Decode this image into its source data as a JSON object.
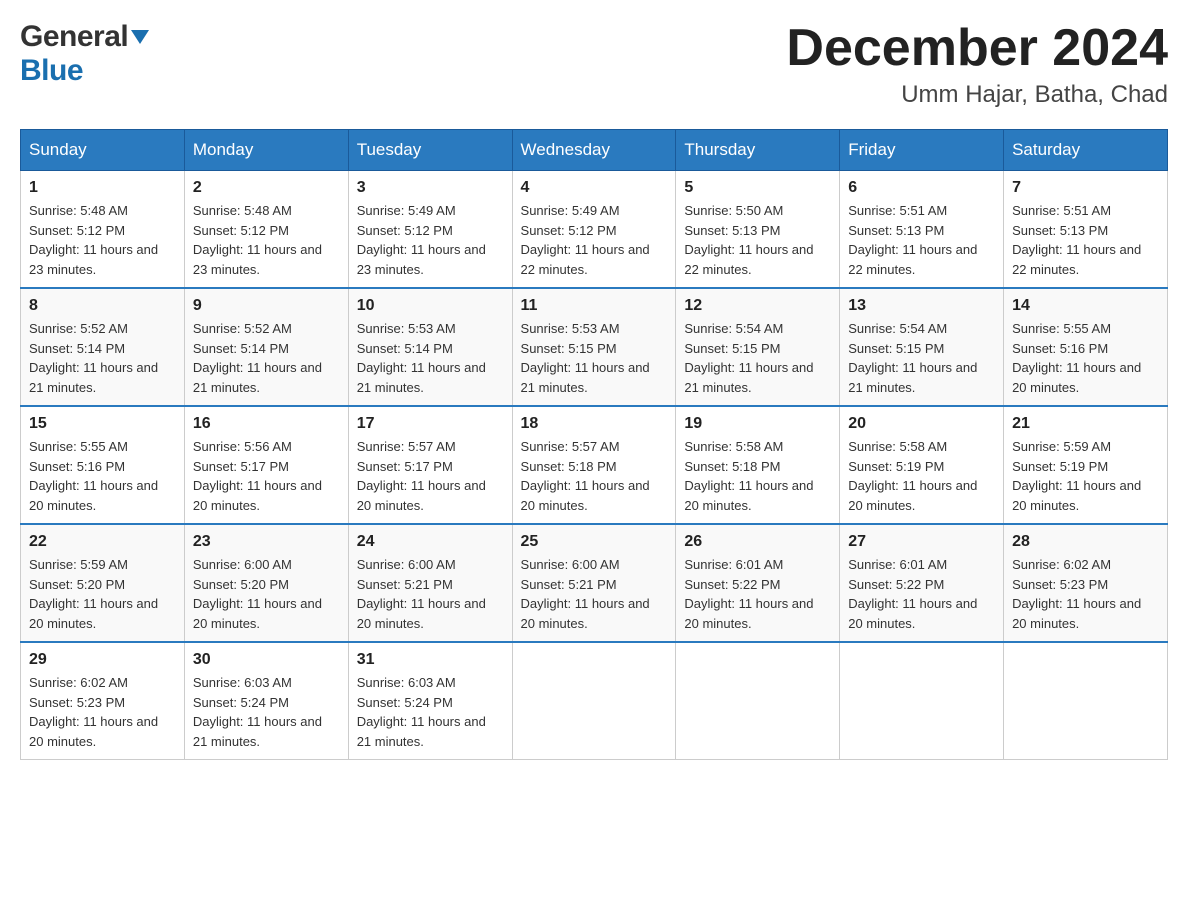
{
  "logo": {
    "general_text": "General",
    "blue_text": "Blue"
  },
  "header": {
    "month_year": "December 2024",
    "location": "Umm Hajar, Batha, Chad"
  },
  "days_of_week": [
    "Sunday",
    "Monday",
    "Tuesday",
    "Wednesday",
    "Thursday",
    "Friday",
    "Saturday"
  ],
  "weeks": [
    [
      {
        "day": "1",
        "sunrise": "5:48 AM",
        "sunset": "5:12 PM",
        "daylight": "11 hours and 23 minutes."
      },
      {
        "day": "2",
        "sunrise": "5:48 AM",
        "sunset": "5:12 PM",
        "daylight": "11 hours and 23 minutes."
      },
      {
        "day": "3",
        "sunrise": "5:49 AM",
        "sunset": "5:12 PM",
        "daylight": "11 hours and 23 minutes."
      },
      {
        "day": "4",
        "sunrise": "5:49 AM",
        "sunset": "5:12 PM",
        "daylight": "11 hours and 22 minutes."
      },
      {
        "day": "5",
        "sunrise": "5:50 AM",
        "sunset": "5:13 PM",
        "daylight": "11 hours and 22 minutes."
      },
      {
        "day": "6",
        "sunrise": "5:51 AM",
        "sunset": "5:13 PM",
        "daylight": "11 hours and 22 minutes."
      },
      {
        "day": "7",
        "sunrise": "5:51 AM",
        "sunset": "5:13 PM",
        "daylight": "11 hours and 22 minutes."
      }
    ],
    [
      {
        "day": "8",
        "sunrise": "5:52 AM",
        "sunset": "5:14 PM",
        "daylight": "11 hours and 21 minutes."
      },
      {
        "day": "9",
        "sunrise": "5:52 AM",
        "sunset": "5:14 PM",
        "daylight": "11 hours and 21 minutes."
      },
      {
        "day": "10",
        "sunrise": "5:53 AM",
        "sunset": "5:14 PM",
        "daylight": "11 hours and 21 minutes."
      },
      {
        "day": "11",
        "sunrise": "5:53 AM",
        "sunset": "5:15 PM",
        "daylight": "11 hours and 21 minutes."
      },
      {
        "day": "12",
        "sunrise": "5:54 AM",
        "sunset": "5:15 PM",
        "daylight": "11 hours and 21 minutes."
      },
      {
        "day": "13",
        "sunrise": "5:54 AM",
        "sunset": "5:15 PM",
        "daylight": "11 hours and 21 minutes."
      },
      {
        "day": "14",
        "sunrise": "5:55 AM",
        "sunset": "5:16 PM",
        "daylight": "11 hours and 20 minutes."
      }
    ],
    [
      {
        "day": "15",
        "sunrise": "5:55 AM",
        "sunset": "5:16 PM",
        "daylight": "11 hours and 20 minutes."
      },
      {
        "day": "16",
        "sunrise": "5:56 AM",
        "sunset": "5:17 PM",
        "daylight": "11 hours and 20 minutes."
      },
      {
        "day": "17",
        "sunrise": "5:57 AM",
        "sunset": "5:17 PM",
        "daylight": "11 hours and 20 minutes."
      },
      {
        "day": "18",
        "sunrise": "5:57 AM",
        "sunset": "5:18 PM",
        "daylight": "11 hours and 20 minutes."
      },
      {
        "day": "19",
        "sunrise": "5:58 AM",
        "sunset": "5:18 PM",
        "daylight": "11 hours and 20 minutes."
      },
      {
        "day": "20",
        "sunrise": "5:58 AM",
        "sunset": "5:19 PM",
        "daylight": "11 hours and 20 minutes."
      },
      {
        "day": "21",
        "sunrise": "5:59 AM",
        "sunset": "5:19 PM",
        "daylight": "11 hours and 20 minutes."
      }
    ],
    [
      {
        "day": "22",
        "sunrise": "5:59 AM",
        "sunset": "5:20 PM",
        "daylight": "11 hours and 20 minutes."
      },
      {
        "day": "23",
        "sunrise": "6:00 AM",
        "sunset": "5:20 PM",
        "daylight": "11 hours and 20 minutes."
      },
      {
        "day": "24",
        "sunrise": "6:00 AM",
        "sunset": "5:21 PM",
        "daylight": "11 hours and 20 minutes."
      },
      {
        "day": "25",
        "sunrise": "6:00 AM",
        "sunset": "5:21 PM",
        "daylight": "11 hours and 20 minutes."
      },
      {
        "day": "26",
        "sunrise": "6:01 AM",
        "sunset": "5:22 PM",
        "daylight": "11 hours and 20 minutes."
      },
      {
        "day": "27",
        "sunrise": "6:01 AM",
        "sunset": "5:22 PM",
        "daylight": "11 hours and 20 minutes."
      },
      {
        "day": "28",
        "sunrise": "6:02 AM",
        "sunset": "5:23 PM",
        "daylight": "11 hours and 20 minutes."
      }
    ],
    [
      {
        "day": "29",
        "sunrise": "6:02 AM",
        "sunset": "5:23 PM",
        "daylight": "11 hours and 20 minutes."
      },
      {
        "day": "30",
        "sunrise": "6:03 AM",
        "sunset": "5:24 PM",
        "daylight": "11 hours and 21 minutes."
      },
      {
        "day": "31",
        "sunrise": "6:03 AM",
        "sunset": "5:24 PM",
        "daylight": "11 hours and 21 minutes."
      },
      null,
      null,
      null,
      null
    ]
  ]
}
